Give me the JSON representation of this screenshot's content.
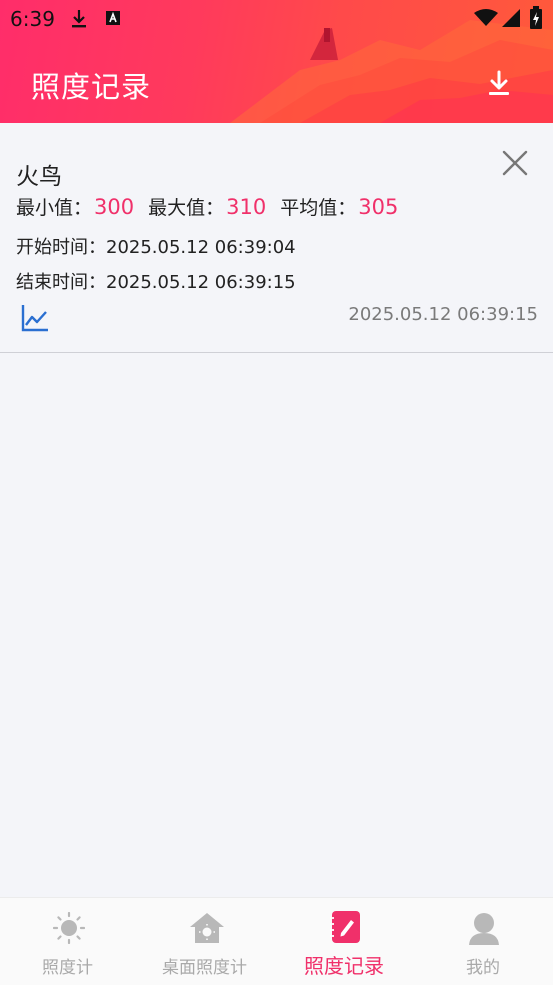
{
  "status_bar": {
    "time": "6:39"
  },
  "header": {
    "title": "照度记录"
  },
  "record": {
    "name": "火鸟",
    "min_label": "最小值：",
    "min_value": "300",
    "max_label": "最大值：",
    "max_value": "310",
    "avg_label": "平均值：",
    "avg_value": "305",
    "start_label": "开始时间：",
    "start_time": "2025.05.12 06:39:04",
    "end_label": "结束时间：",
    "end_time": "2025.05.12 06:39:15",
    "record_time": "2025.05.12 06:39:15"
  },
  "nav": {
    "items": [
      {
        "label": "照度计",
        "icon": "sun-icon",
        "active": false
      },
      {
        "label": "桌面照度计",
        "icon": "home-icon",
        "active": false
      },
      {
        "label": "照度记录",
        "icon": "edit-note-icon",
        "active": true
      },
      {
        "label": "我的",
        "icon": "person-icon",
        "active": false
      }
    ]
  },
  "colors": {
    "accent": "#f0306a",
    "header_start": "#ff2d6a",
    "header_end": "#ff5a3a",
    "inactive": "#a9a9a9",
    "chart_icon": "#2a6fd1"
  }
}
